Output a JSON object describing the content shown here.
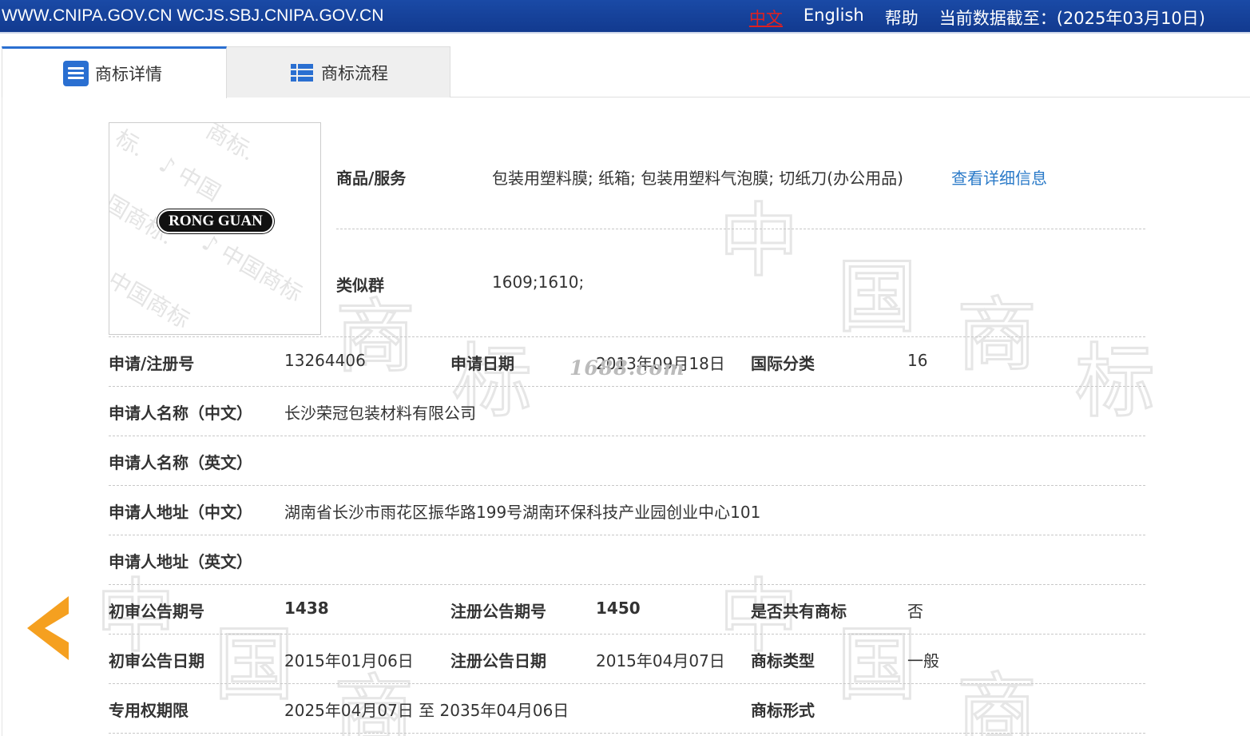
{
  "topbar": {
    "site": "WWW.CNIPA.GOV.CN WCJS.SBJ.CNIPA.GOV.CN",
    "lang_zh": "中文",
    "lang_en": "English",
    "help": "帮助",
    "data_date": "当前数据截至：(2025年03月10日)"
  },
  "tabs": [
    {
      "label": "商标详情",
      "icon": "document-icon"
    },
    {
      "label": "商标流程",
      "icon": "list-icon"
    }
  ],
  "trademark": {
    "image_text": "RONG GUAN"
  },
  "goods": {
    "label": "商品/服务",
    "value": "包装用塑料膜; 纸箱; 包装用塑料气泡膜; 切纸刀(办公用品)",
    "link": "查看详细信息"
  },
  "similar": {
    "label": "类似群",
    "value": "1609;1610;"
  },
  "rows": {
    "reg_no": {
      "label": "申请/注册号",
      "value": "13264406"
    },
    "app_date": {
      "label": "申请日期",
      "value": "2013年09月18日"
    },
    "intl_class": {
      "label": "国际分类",
      "value": "16"
    },
    "applicant_cn": {
      "label": "申请人名称（中文）",
      "value": "长沙荣冠包装材料有限公司"
    },
    "applicant_en": {
      "label": "申请人名称（英文）",
      "value": ""
    },
    "address_cn": {
      "label": "申请人地址（中文）",
      "value": "湖南省长沙市雨花区振华路199号湖南环保科技产业园创业中心101"
    },
    "address_en": {
      "label": "申请人地址（英文）",
      "value": ""
    },
    "prelim_no": {
      "label": "初审公告期号",
      "value": "1438"
    },
    "reg_pub_no": {
      "label": "注册公告期号",
      "value": "1450"
    },
    "shared": {
      "label": "是否共有商标",
      "value": "否"
    },
    "prelim_date": {
      "label": "初审公告日期",
      "value": "2015年01月06日"
    },
    "reg_pub_date": {
      "label": "注册公告日期",
      "value": "2015年04月07日"
    },
    "tm_type": {
      "label": "商标类型",
      "value": "一般"
    },
    "validity": {
      "label": "专用权期限",
      "value": "2025年04月07日 至 2035年04月06日"
    },
    "tm_form": {
      "label": "商标形式",
      "value": ""
    }
  },
  "overlay_watermark": "1688.com",
  "colors": {
    "topbar": "#1a4aa6",
    "accent": "#2a6fd1",
    "link": "#2a7ac8",
    "back_arrow": "#f5a020"
  }
}
